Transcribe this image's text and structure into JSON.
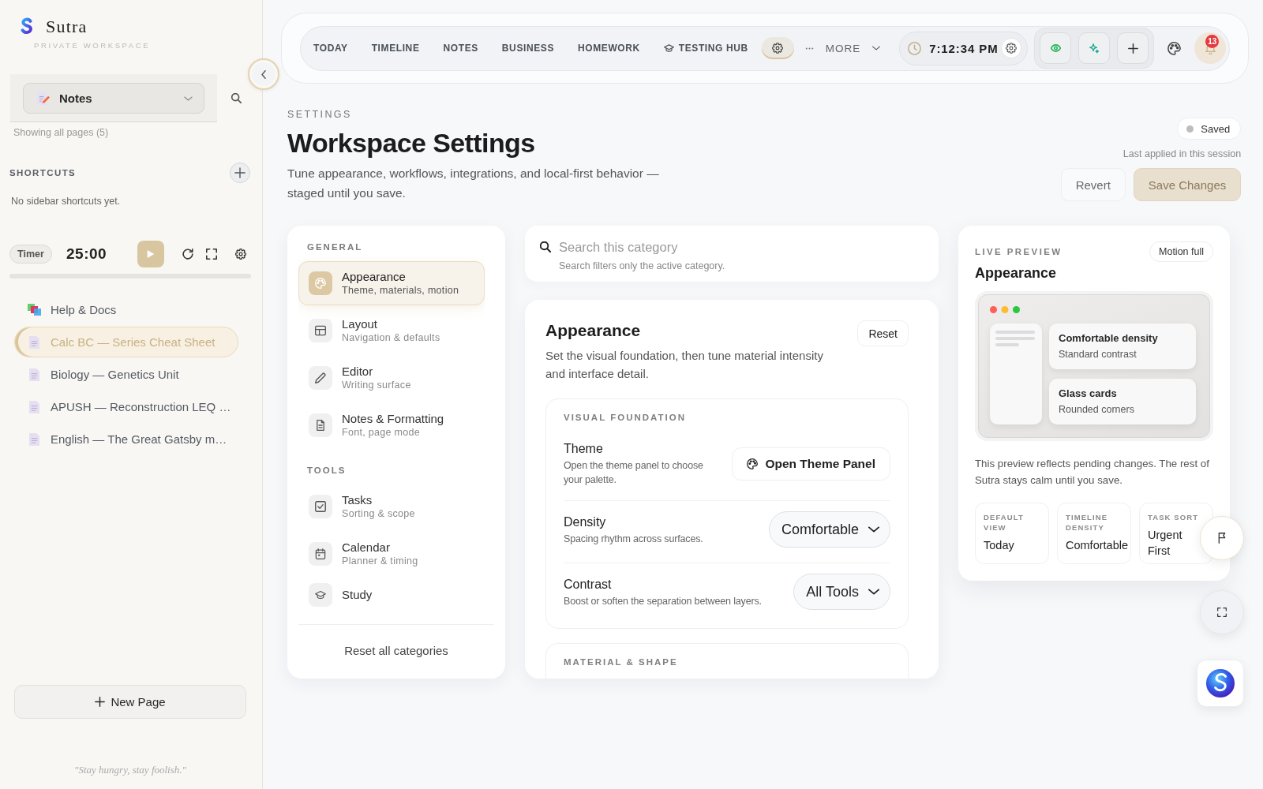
{
  "sidebar": {
    "brand": {
      "name": "Sutra",
      "subtitle": "PRIVATE WORKSPACE"
    },
    "page_selector": {
      "value": "Notes"
    },
    "filter_note": "Showing all pages (5)",
    "shortcuts": {
      "title": "SHORTCUTS",
      "empty_text": "No sidebar shortcuts yet."
    },
    "timer": {
      "label": "Timer",
      "time": "25:00"
    },
    "pages": [
      {
        "kind": "help",
        "label": "Help & Docs",
        "selected": false
      },
      {
        "kind": "page",
        "label": "Calc BC — Series Cheat Sheet",
        "selected": true
      },
      {
        "kind": "page",
        "label": "Biology — Genetics Unit",
        "selected": false
      },
      {
        "kind": "page",
        "label": "APUSH — Reconstruction LEQ …",
        "selected": false
      },
      {
        "kind": "page",
        "label": "English — The Great Gatsby m…",
        "selected": false
      }
    ],
    "new_page_button": "New Page",
    "quote": "\"Stay hungry, stay foolish.\""
  },
  "top_bar": {
    "tabs": [
      {
        "kind": "text",
        "label": "TODAY",
        "selected": false
      },
      {
        "kind": "text",
        "label": "TIMELINE",
        "selected": false
      },
      {
        "kind": "text",
        "label": "NOTES",
        "selected": false
      },
      {
        "kind": "text",
        "label": "BUSINESS",
        "selected": false
      },
      {
        "kind": "text",
        "label": "HOMEWORK",
        "selected": false
      },
      {
        "kind": "hub",
        "label": "TESTING HUB",
        "selected": false
      },
      {
        "kind": "settings",
        "selected": true
      }
    ],
    "more": {
      "label": "MORE"
    },
    "clock": {
      "time": "7:12:34 PM"
    },
    "notifications": {
      "count": "13"
    }
  },
  "header": {
    "eyebrow": "SETTINGS",
    "title": "Workspace Settings",
    "description": "Tune appearance, workflows, integrations, and local-first behavior — staged until you save.",
    "status": {
      "label": "Saved"
    },
    "status_note": "Last applied in this session",
    "buttons": [
      {
        "kind": "secondary",
        "label": "Revert",
        "disabled": false
      },
      {
        "kind": "primary",
        "label": "Save Changes",
        "disabled": true
      }
    ]
  },
  "category_nav": {
    "groups": [
      {
        "title": "GENERAL",
        "items": [
          {
            "label": "Appearance",
            "description": "Theme, materials, motion",
            "selected": true
          },
          {
            "label": "Layout",
            "description": "Navigation & defaults",
            "selected": false
          },
          {
            "label": "Editor",
            "description": "Writing surface",
            "selected": false
          },
          {
            "label": "Notes & Formatting",
            "description": "Font, page mode",
            "selected": false
          }
        ]
      },
      {
        "title": "TOOLS",
        "items": [
          {
            "label": "Tasks",
            "description": "Sorting & scope",
            "selected": false
          },
          {
            "label": "Calendar",
            "description": "Planner & timing",
            "selected": false
          },
          {
            "label": "Study",
            "selected": false
          }
        ]
      }
    ],
    "reset_all": "Reset all categories"
  },
  "search": {
    "placeholder": "Search this category",
    "hint": "Search filters only the active category."
  },
  "section": {
    "title": "Appearance",
    "description": "Set the visual foundation, then tune material intensity and interface detail.",
    "reset": "Reset",
    "groups": [
      {
        "title": "VISUAL FOUNDATION",
        "rows": [
          {
            "kind": "button",
            "label": "Theme",
            "description": "Open the theme panel to choose your palette.",
            "control": "Open Theme Panel"
          },
          {
            "kind": "select",
            "label": "Density",
            "description": "Spacing rhythm across surfaces.",
            "value": "Comfortable"
          },
          {
            "kind": "select",
            "label": "Contrast",
            "description": "Boost or soften the separation between layers.",
            "value": "All Tools"
          }
        ]
      },
      {
        "title": "MATERIAL & SHAPE"
      }
    ]
  },
  "preview": {
    "eyebrow": "LIVE PREVIEW",
    "badge": "Motion full",
    "title": "Appearance",
    "mock_cards": [
      {
        "title": "Comfortable density",
        "subtitle": "Standard contrast"
      },
      {
        "title": "Glass cards",
        "subtitle": "Rounded corners"
      }
    ],
    "note": "This preview reflects pending changes. The rest of Sutra stays calm until you save.",
    "stats": [
      {
        "label": "DEFAULT VIEW",
        "value": "Today"
      },
      {
        "label": "TIMELINE DENSITY",
        "value": "Comfortable"
      },
      {
        "label": "TASK SORT",
        "value": "Urgent First"
      }
    ]
  }
}
